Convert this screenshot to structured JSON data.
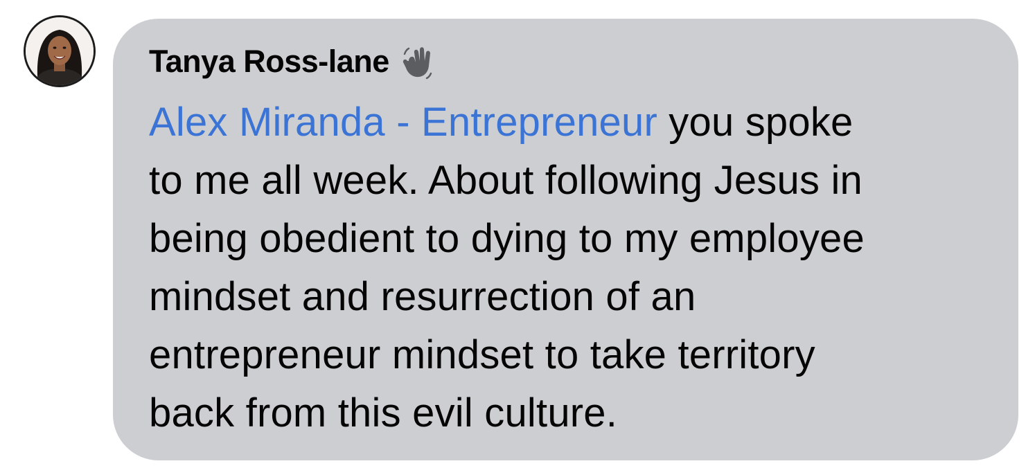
{
  "comment": {
    "author": "Tanya Ross-lane",
    "badge_icon": "waving-hand-icon",
    "avatar_icon": "user-avatar",
    "mention": "Alex Miranda - Entrepreneur",
    "lines": [
      " you spoke",
      "to me all week. About following Jesus in",
      "being obedient to dying to my employee",
      "mindset and resurrection of an",
      "entrepreneur mindset to take territory",
      "back from this evil culture."
    ]
  },
  "colors": {
    "bubble_background": "#ccced2",
    "mention_link": "#3b74d4",
    "text": "#050505"
  }
}
